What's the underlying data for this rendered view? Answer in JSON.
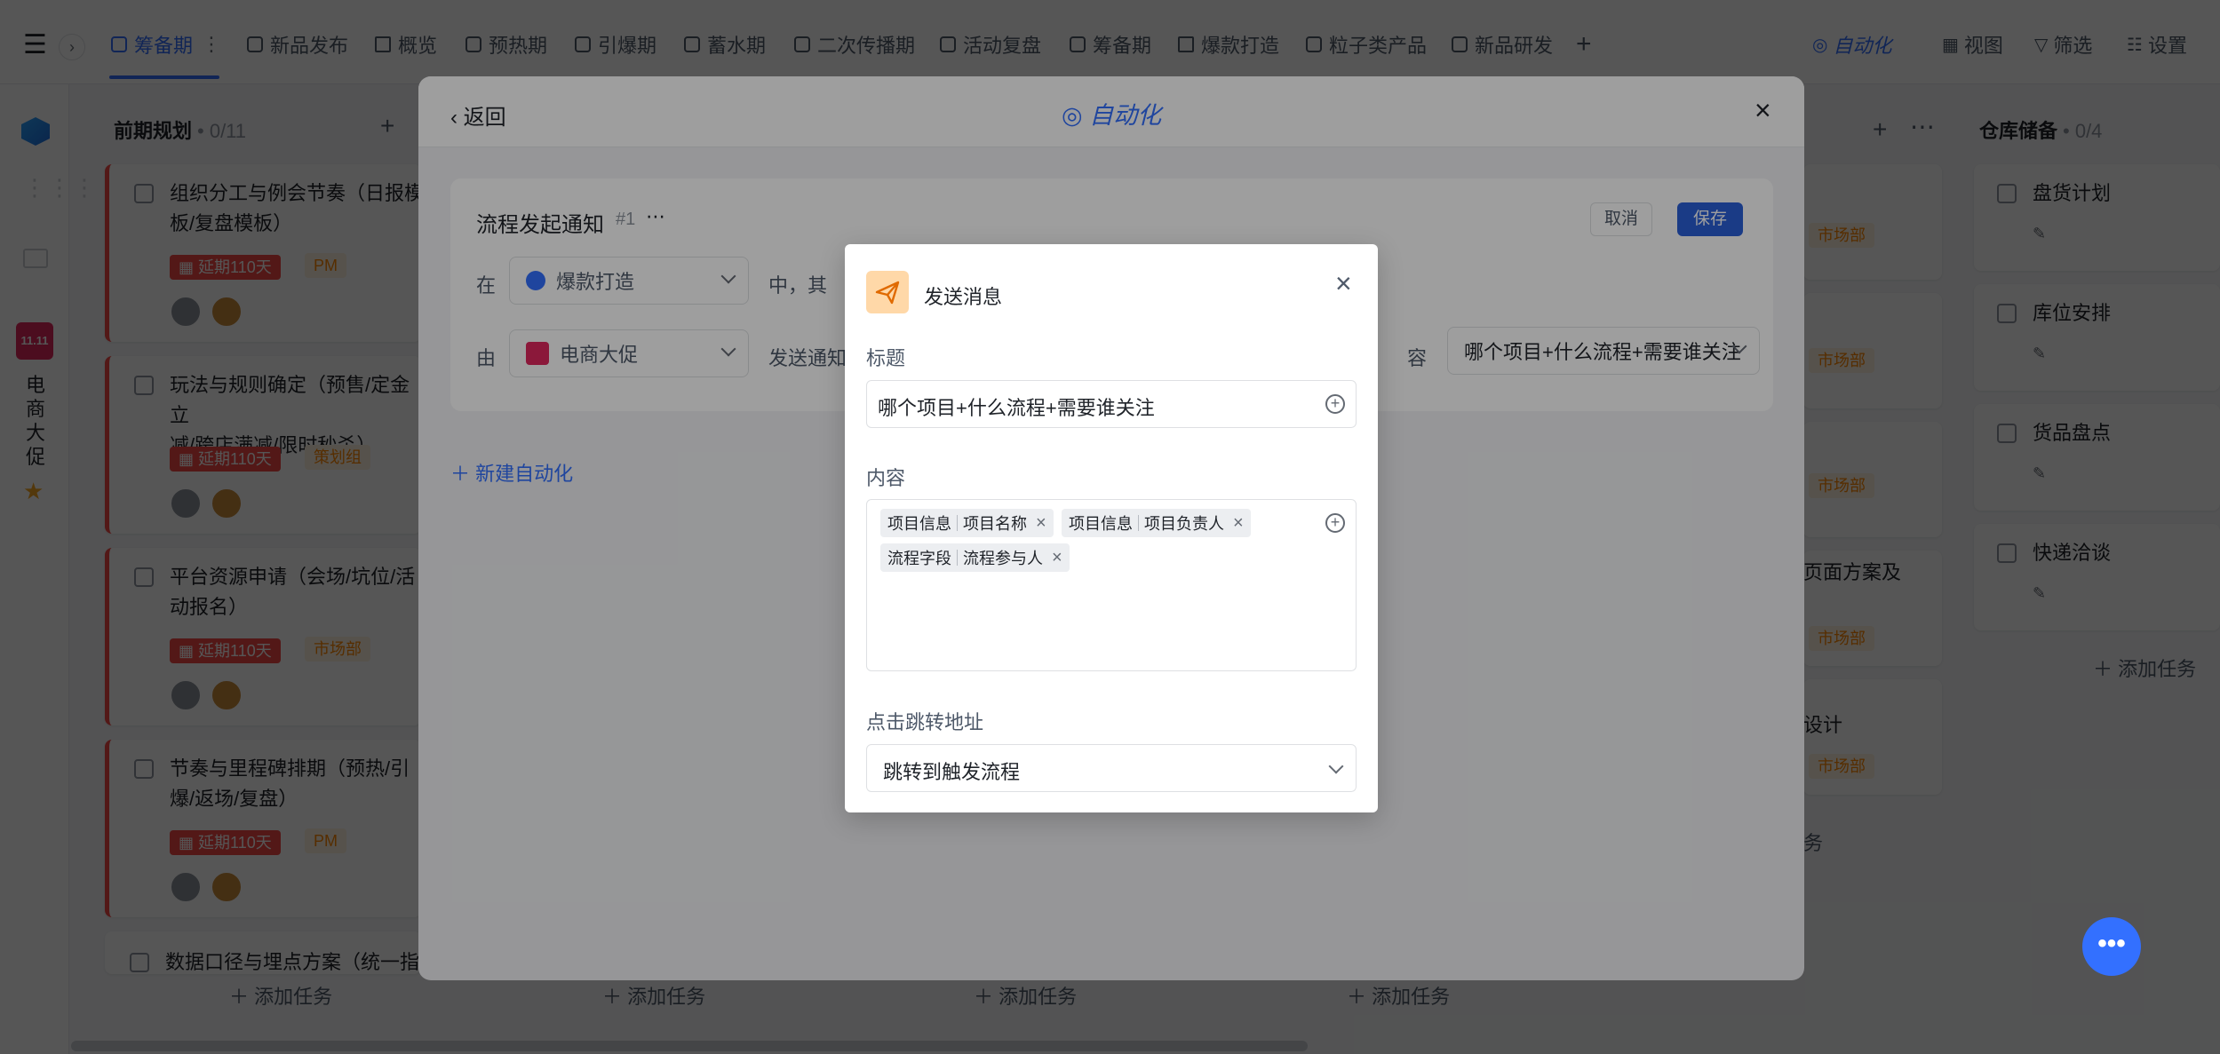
{
  "topbar": {
    "tabs": [
      "筹备期",
      "新品发布",
      "概览",
      "预热期",
      "引爆期",
      "蓄水期",
      "二次传播期",
      "活动复盘",
      "筹备期",
      "爆款打造",
      "粒子类产品",
      "新品研发"
    ],
    "actions": {
      "automation": "自动化",
      "view": "视图",
      "filter": "筛选",
      "settings": "设置"
    }
  },
  "sidebar": {
    "project_name": [
      "电",
      "商",
      "大",
      "促"
    ],
    "logo_text": "11.11"
  },
  "board": {
    "col1": {
      "title": "前期规划",
      "count": "• 0/11",
      "cards": [
        {
          "title_lines": [
            "组织分工与例会节奏（日报模",
            "板/复盘模板）"
          ],
          "delay": "延期110天",
          "tag": "PM"
        },
        {
          "title_lines": [
            "玩法与规则确定（预售/定金立",
            "减/跨店满减/限时秒杀）"
          ],
          "delay": "延期110天",
          "tag": "策划组"
        },
        {
          "title_lines": [
            "平台资源申请（会场/坑位/活",
            "动报名）"
          ],
          "delay": "延期110天",
          "tag": "市场部"
        },
        {
          "title_lines": [
            "节奏与里程碑排期（预热/引",
            "爆/返场/复盘）"
          ],
          "delay": "延期110天",
          "tag": "PM"
        },
        {
          "title_lines": [
            "数据口径与埋点方案（统一指"
          ]
        }
      ]
    },
    "col_right": {
      "title": "仓库储备",
      "count": "• 0/4",
      "cards": [
        "盘货计划",
        "库位安排",
        "货品盘点",
        "快递洽谈"
      ]
    },
    "hidden_col_tags": [
      "市场部",
      "市场部",
      "市场部",
      "市场部",
      "市场部"
    ],
    "hidden_col_texts": [
      "页面方案及",
      "设计",
      "务"
    ],
    "add_task": "添加任务"
  },
  "automation": {
    "back": "返回",
    "title": "自动化",
    "flow_name": "流程发起通知",
    "flow_id": "#1",
    "cancel": "取消",
    "save": "保存",
    "row1_prefix": "在",
    "row1_select": "爆款打造",
    "row1_suffix": "中，其",
    "row2_prefix": "由",
    "row2_select": "电商大促",
    "row2_action": "发送通知",
    "row2_content_label": "容",
    "row2_content_value": "哪个项目+什么流程+需要谁关注",
    "new_automation": "新建自动化"
  },
  "dialog": {
    "title": "发送消息",
    "title_label": "标题",
    "title_value": "哪个项目+什么流程+需要谁关注",
    "content_label": "内容",
    "chips": [
      {
        "group": "项目信息",
        "field": "项目名称"
      },
      {
        "group": "项目信息",
        "field": "项目负责人"
      },
      {
        "group": "流程字段",
        "field": "流程参与人"
      }
    ],
    "jump_label": "点击跳转地址",
    "jump_value": "跳转到触发流程"
  },
  "colors": {
    "accent": "#3370ff",
    "delay_red": "#f54a45",
    "tag_orange": "#ff8800",
    "send_icon_bg": "#ffd8a8"
  }
}
